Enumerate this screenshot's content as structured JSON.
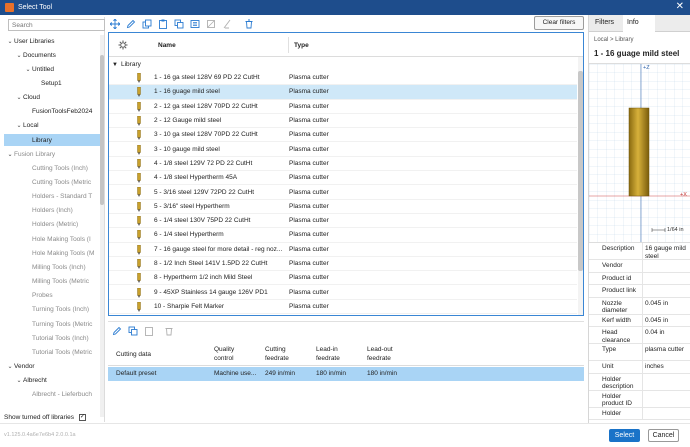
{
  "window": {
    "title": "Select Tool"
  },
  "left": {
    "search_placeholder": "Search",
    "tree": [
      {
        "label": "User Libraries",
        "indent": 0,
        "chev": "v",
        "grey": false,
        "sel": false
      },
      {
        "label": "Documents",
        "indent": 1,
        "chev": "v",
        "grey": false,
        "sel": false
      },
      {
        "label": "Untitled",
        "indent": 2,
        "chev": "v",
        "grey": false,
        "sel": false
      },
      {
        "label": "Setup1",
        "indent": 3,
        "chev": "",
        "grey": false,
        "sel": false
      },
      {
        "label": "Cloud",
        "indent": 1,
        "chev": "v",
        "grey": false,
        "sel": false
      },
      {
        "label": "FusionToolsFeb2024",
        "indent": 2,
        "chev": "",
        "grey": false,
        "sel": false
      },
      {
        "label": "Local",
        "indent": 1,
        "chev": "v",
        "grey": false,
        "sel": false
      },
      {
        "label": "Library",
        "indent": 2,
        "chev": "",
        "grey": false,
        "sel": true
      },
      {
        "label": "Fusion Library",
        "indent": 0,
        "chev": "v",
        "grey": true,
        "sel": false
      },
      {
        "label": "Cutting Tools (Inch)",
        "indent": 2,
        "chev": "",
        "grey": true,
        "sel": false
      },
      {
        "label": "Cutting Tools (Metric",
        "indent": 2,
        "chev": "",
        "grey": true,
        "sel": false
      },
      {
        "label": "Holders - Standard T",
        "indent": 2,
        "chev": "",
        "grey": true,
        "sel": false
      },
      {
        "label": "Holders (Inch)",
        "indent": 2,
        "chev": "",
        "grey": true,
        "sel": false
      },
      {
        "label": "Holders (Metric)",
        "indent": 2,
        "chev": "",
        "grey": true,
        "sel": false
      },
      {
        "label": "Hole Making Tools (I",
        "indent": 2,
        "chev": "",
        "grey": true,
        "sel": false
      },
      {
        "label": "Hole Making Tools (M",
        "indent": 2,
        "chev": "",
        "grey": true,
        "sel": false
      },
      {
        "label": "Milling Tools (Inch)",
        "indent": 2,
        "chev": "",
        "grey": true,
        "sel": false
      },
      {
        "label": "Milling Tools (Metric",
        "indent": 2,
        "chev": "",
        "grey": true,
        "sel": false
      },
      {
        "label": "Probes",
        "indent": 2,
        "chev": "",
        "grey": true,
        "sel": false
      },
      {
        "label": "Turning Tools (Inch)",
        "indent": 2,
        "chev": "",
        "grey": true,
        "sel": false
      },
      {
        "label": "Turning Tools (Metric",
        "indent": 2,
        "chev": "",
        "grey": true,
        "sel": false
      },
      {
        "label": "Tutorial Tools (Inch)",
        "indent": 2,
        "chev": "",
        "grey": true,
        "sel": false
      },
      {
        "label": "Tutorial Tools (Metric",
        "indent": 2,
        "chev": "",
        "grey": true,
        "sel": false
      },
      {
        "label": "Vendor",
        "indent": 0,
        "chev": "v",
        "grey": false,
        "sel": false
      },
      {
        "label": "Albrecht",
        "indent": 1,
        "chev": "v",
        "grey": false,
        "sel": false
      },
      {
        "label": "Albrecht - Lieferbuch",
        "indent": 2,
        "chev": "",
        "grey": true,
        "sel": false
      }
    ],
    "show_off_label": "Show turned off libraries",
    "show_off_checked": "✓"
  },
  "toolbar": {
    "clear_filters": "Clear filters"
  },
  "table": {
    "col_name": "Name",
    "col_type": "Type",
    "group": "Library",
    "rows": [
      {
        "name": "1 - 16 ga steel 128V 69 PD 22 CutHt",
        "type": "Plasma cutter"
      },
      {
        "name": "1 - 16 guage mild steel",
        "type": "Plasma cutter"
      },
      {
        "name": "2 - 12 ga steel 128V 70PD 22 CutHt",
        "type": "Plasma cutter"
      },
      {
        "name": "2 - 12 Gauge mild steel",
        "type": "Plasma cutter"
      },
      {
        "name": "3 - 10 ga steel 128V 70PD 22 CutHt",
        "type": "Plasma cutter"
      },
      {
        "name": "3 - 10 gauge mild steel",
        "type": "Plasma cutter"
      },
      {
        "name": "4 - 1/8 steel 129V 72 PD 22 CutHt",
        "type": "Plasma cutter"
      },
      {
        "name": "4 - 1/8 steel Hypertherm 45A",
        "type": "Plasma cutter"
      },
      {
        "name": "5 - 3/16 steel 129V 72PD 22 CutHt",
        "type": "Plasma cutter"
      },
      {
        "name": "5 - 3/16\" steel Hypertherm",
        "type": "Plasma cutter"
      },
      {
        "name": "6 - 1/4 steel 130V 75PD 22 CutHt",
        "type": "Plasma cutter"
      },
      {
        "name": "6 - 1/4 steel Hypertherm",
        "type": "Plasma cutter"
      },
      {
        "name": "7 - 16 gauge steel for more detail - reg noz...",
        "type": "Plasma cutter"
      },
      {
        "name": "8 - 1/2 Inch Steel 141V 1.5PD 22 CutHt",
        "type": "Plasma cutter"
      },
      {
        "name": "8 - Hypertherm 1/2 inch Mild Steel",
        "type": "Plasma cutter"
      },
      {
        "name": "9 - 45XP Stainless 14 gauge 126V PD1",
        "type": "Plasma cutter"
      },
      {
        "name": "10 - Sharpie Felt Marker",
        "type": "Plasma cutter"
      }
    ],
    "selected_index": 1
  },
  "presets": {
    "headers": {
      "cutting_data": "Cutting data",
      "quality": "Quality\ncontrol",
      "cut_feed": "Cutting\nfeedrate",
      "leadin": "Lead-in\nfeedrate",
      "leadout": "Lead-out\nfeedrate"
    },
    "row": {
      "name": "Default preset",
      "quality": "Machine use...",
      "cut_feed": "249 in/min",
      "leadin": "180 in/min",
      "leadout": "180 in/min"
    }
  },
  "right": {
    "tabs": [
      "Filters",
      "Info"
    ],
    "active_tab": "Info",
    "breadcrumb": "Local  >  Library",
    "title": "1 - 16 guage mild steel",
    "preview": {
      "axis_z": "+Z",
      "axis_x": "+X",
      "scale": "1/64 in"
    },
    "props": [
      {
        "k": "Description",
        "v": "16 gauge mild steel",
        "lines": 2
      },
      {
        "k": "Vendor",
        "v": "",
        "lines": 1
      },
      {
        "k": "Product id",
        "v": "",
        "lines": 1
      },
      {
        "k": "Product link",
        "v": "",
        "lines": 1
      },
      {
        "k": "Nozzle diameter",
        "v": "0.045 in",
        "lines": 2
      },
      {
        "k": "Kerf width",
        "v": "0.045 in",
        "lines": 1
      },
      {
        "k": "Head clearance",
        "v": "0.04 in",
        "lines": 2
      },
      {
        "k": "Type",
        "v": "plasma cutter",
        "lines": 2
      },
      {
        "k": "Unit",
        "v": "inches",
        "lines": 1
      },
      {
        "k": "Holder description",
        "v": "",
        "lines": 2
      },
      {
        "k": "Holder product ID",
        "v": "",
        "lines": 2
      },
      {
        "k": "Holder",
        "v": "",
        "lines": 1
      }
    ]
  },
  "status": {
    "version": "v1.125.0.4a6e7e6b4 2.0.0.1a",
    "select": "Select",
    "cancel": "Cancel"
  }
}
